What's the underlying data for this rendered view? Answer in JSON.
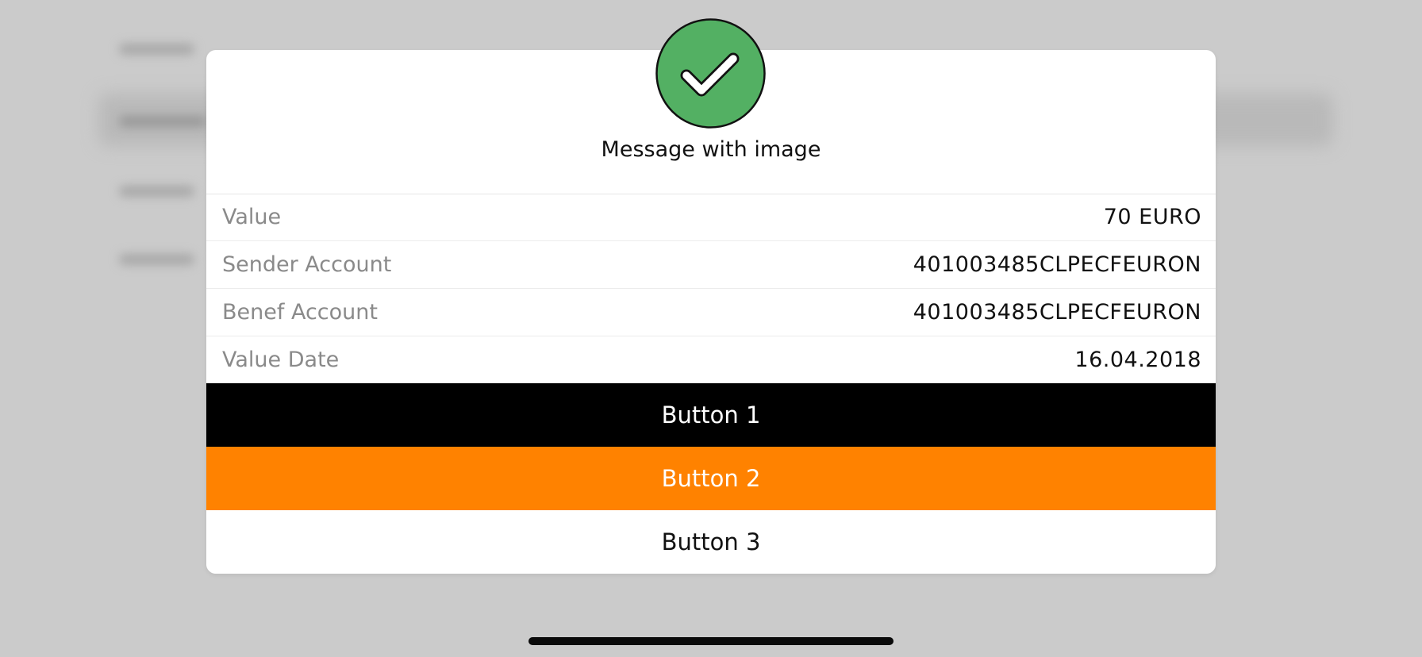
{
  "dialog": {
    "message": "Message with image",
    "badge_icon": "checkmark-circle-icon",
    "badge_color": "#53b063",
    "rows": [
      {
        "label": "Value",
        "value": "70 EURO"
      },
      {
        "label": "Sender Account",
        "value": "401003485CLPECFEURON"
      },
      {
        "label": "Benef Account",
        "value": "401003485CLPECFEURON"
      },
      {
        "label": "Value Date",
        "value": "16.04.2018"
      }
    ],
    "buttons": [
      {
        "label": "Button 1",
        "background": "#000000",
        "color": "#ffffff"
      },
      {
        "label": "Button 2",
        "background": "#ff8200",
        "color": "#ffffff"
      },
      {
        "label": "Button 3",
        "background": "#ffffff",
        "color": "#111111"
      }
    ]
  },
  "colors": {
    "backdrop": "#cbcbcb",
    "dialog_background": "#ffffff",
    "label_gray": "#8a8a8a",
    "home_indicator": "#0a0a0a"
  }
}
